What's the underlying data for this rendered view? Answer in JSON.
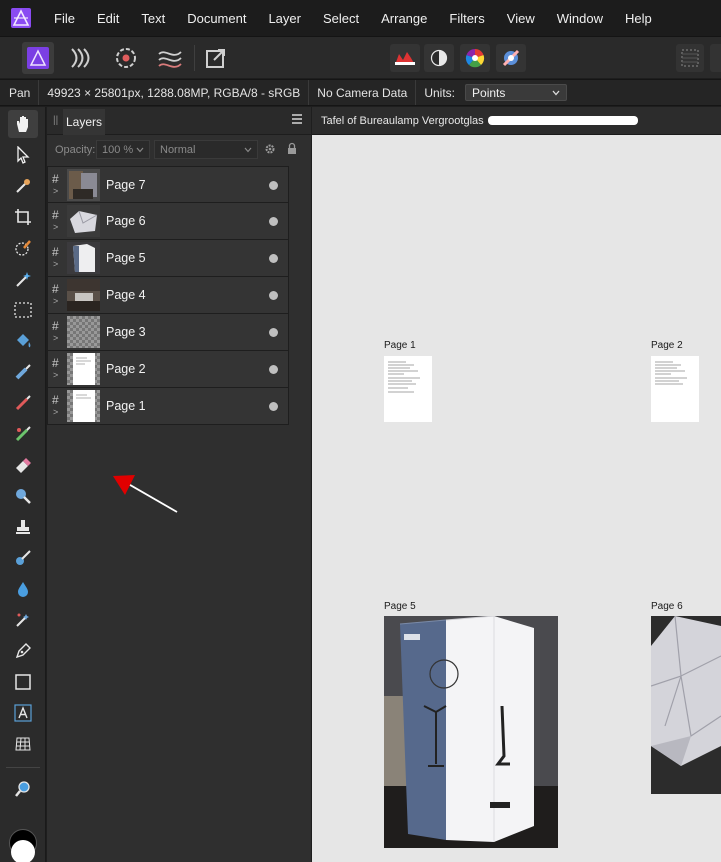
{
  "menubar": {
    "items": [
      "File",
      "Edit",
      "Text",
      "Document",
      "Layer",
      "Select",
      "Arrange",
      "Filters",
      "View",
      "Window",
      "Help"
    ]
  },
  "contextbar": {
    "tool_name": "Pan",
    "doc_info": "49923 × 25801px, 1288.08MP, RGBA/8 - sRGB",
    "camera": "No Camera Data",
    "units_label": "Units:",
    "units_value": "Points"
  },
  "layers_panel": {
    "tab_label": "Layers",
    "opacity_label": "Opacity:",
    "opacity_value": "100 %",
    "blend_mode": "Normal",
    "layers": [
      {
        "name": "Page 7"
      },
      {
        "name": "Page 6"
      },
      {
        "name": "Page 5"
      },
      {
        "name": "Page 4"
      },
      {
        "name": "Page 3"
      },
      {
        "name": "Page 2"
      },
      {
        "name": "Page 1"
      }
    ]
  },
  "document": {
    "title": "Tafel of Bureaulamp Vergrootglas"
  },
  "canvas": {
    "pages": [
      {
        "label": "Page 1",
        "kind": "document"
      },
      {
        "label": "Page 2",
        "kind": "document"
      },
      {
        "label": "Page 5",
        "kind": "photo-box"
      },
      {
        "label": "Page 6",
        "kind": "photo-crumpled"
      }
    ]
  },
  "colors": {
    "accent_purple": "#7b3fe4",
    "annotation_red": "#e00000",
    "canvas_bg": "#e6e6e6"
  }
}
